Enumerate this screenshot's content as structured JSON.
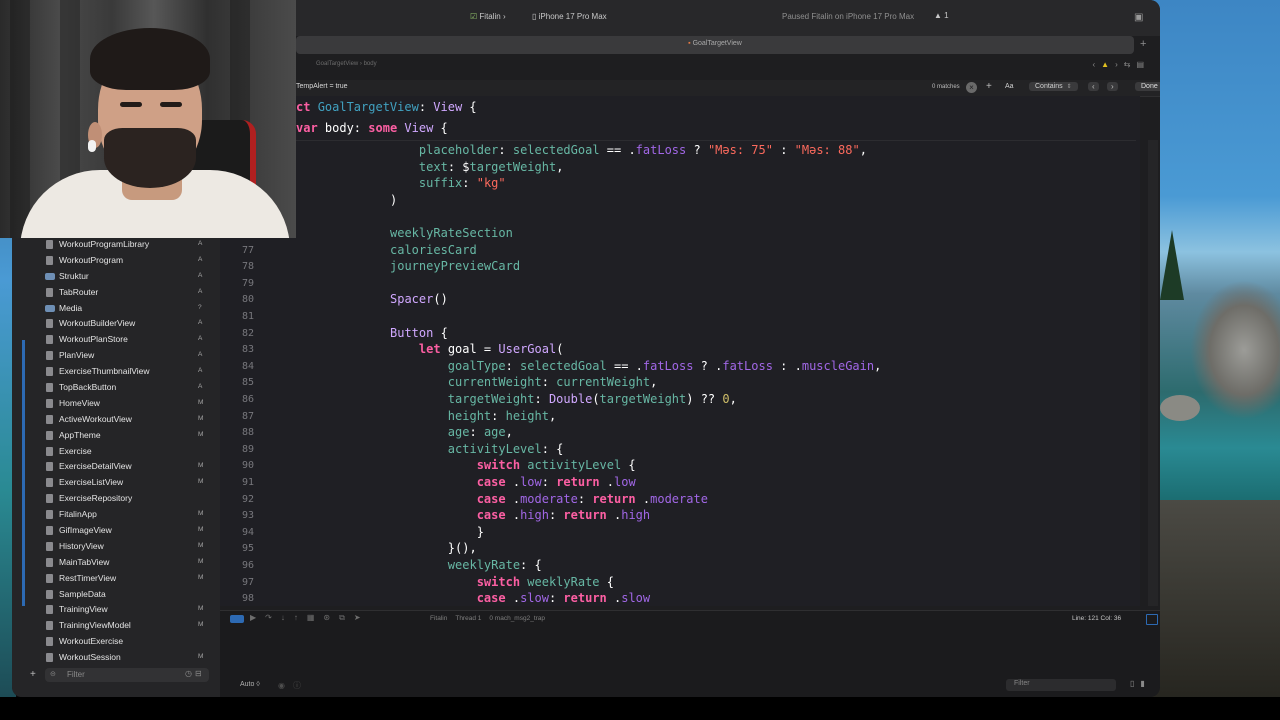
{
  "toolbar": {
    "scheme": "Fitalin",
    "device": "iPhone 17 Pro Max",
    "status": "Paused Fitalin on iPhone 17 Pro Max",
    "warnings": "1"
  },
  "tab": {
    "title": "GoalTargetView"
  },
  "jumpbar": {
    "path": "GoalTargetView  ›  body"
  },
  "find": {
    "query": "TempAlert = true",
    "matches": "0 matches",
    "case_label": "Aa",
    "mode": "Contains",
    "done_label": "Done"
  },
  "navigator": {
    "items": [
      {
        "label": "WorkoutProgramLibrary",
        "badge": "A",
        "kind": "file"
      },
      {
        "label": "WorkoutProgram",
        "badge": "A",
        "kind": "file"
      },
      {
        "label": "Struktur",
        "badge": "A",
        "kind": "folder"
      },
      {
        "label": "TabRouter",
        "badge": "A",
        "kind": "file"
      },
      {
        "label": "Media",
        "badge": "?",
        "kind": "folder"
      },
      {
        "label": "WorkoutBuilderView",
        "badge": "A",
        "kind": "file"
      },
      {
        "label": "WorkoutPlanStore",
        "badge": "A",
        "kind": "file"
      },
      {
        "label": "PlanView",
        "badge": "A",
        "kind": "file"
      },
      {
        "label": "ExerciseThumbnailView",
        "badge": "A",
        "kind": "file"
      },
      {
        "label": "TopBackButton",
        "badge": "A",
        "kind": "file"
      },
      {
        "label": "HomeView",
        "badge": "M",
        "kind": "file"
      },
      {
        "label": "ActiveWorkoutView",
        "badge": "M",
        "kind": "file"
      },
      {
        "label": "AppTheme",
        "badge": "M",
        "kind": "file"
      },
      {
        "label": "Exercise",
        "badge": "",
        "kind": "file"
      },
      {
        "label": "ExerciseDetailView",
        "badge": "M",
        "kind": "file"
      },
      {
        "label": "ExerciseListView",
        "badge": "M",
        "kind": "file"
      },
      {
        "label": "ExerciseRepository",
        "badge": "",
        "kind": "file"
      },
      {
        "label": "FitalinApp",
        "badge": "M",
        "kind": "file"
      },
      {
        "label": "GifImageView",
        "badge": "M",
        "kind": "file"
      },
      {
        "label": "HistoryView",
        "badge": "M",
        "kind": "file"
      },
      {
        "label": "MainTabView",
        "badge": "M",
        "kind": "file"
      },
      {
        "label": "RestTimerView",
        "badge": "M",
        "kind": "file"
      },
      {
        "label": "SampleData",
        "badge": "",
        "kind": "file"
      },
      {
        "label": "TrainingView",
        "badge": "M",
        "kind": "file"
      },
      {
        "label": "TrainingViewModel",
        "badge": "M",
        "kind": "file"
      },
      {
        "label": "WorkoutExercise",
        "badge": "",
        "kind": "file"
      },
      {
        "label": "WorkoutSession",
        "badge": "M",
        "kind": "file"
      }
    ],
    "filter_placeholder": "Filter"
  },
  "editor": {
    "scope_lines": [
      [
        [
          "kw",
          "ct "
        ],
        [
          "decl",
          "GoalTargetView"
        ],
        [
          "plain",
          ": "
        ],
        [
          "type",
          "View"
        ],
        [
          "plain",
          " {"
        ]
      ],
      [
        [
          "kw",
          "var "
        ],
        [
          "plain",
          "body: "
        ],
        [
          "kw",
          "some "
        ],
        [
          "type",
          "View"
        ],
        [
          "plain",
          " {"
        ]
      ]
    ],
    "lines": [
      {
        "n": "",
        "parts": [
          [
            "plain",
            "    "
          ],
          [
            "prop",
            "placeholder"
          ],
          [
            "plain",
            ": "
          ],
          [
            "prop",
            "selectedGoal"
          ],
          [
            "plain",
            " == ."
          ],
          [
            "enum",
            "fatLoss"
          ],
          [
            "plain",
            " ? "
          ],
          [
            "str",
            "\"Məs: 75\""
          ],
          [
            "plain",
            " : "
          ],
          [
            "str",
            "\"Məs: 88\""
          ],
          [
            "plain",
            ","
          ]
        ]
      },
      {
        "n": "",
        "parts": [
          [
            "plain",
            "    "
          ],
          [
            "prop",
            "text"
          ],
          [
            "plain",
            ": $"
          ],
          [
            "prop",
            "targetWeight"
          ],
          [
            "plain",
            ","
          ]
        ]
      },
      {
        "n": "",
        "parts": [
          [
            "plain",
            "    "
          ],
          [
            "prop",
            "suffix"
          ],
          [
            "plain",
            ": "
          ],
          [
            "str",
            "\"kg\""
          ]
        ]
      },
      {
        "n": "",
        "parts": [
          [
            "plain",
            ")"
          ]
        ]
      },
      {
        "n": "",
        "parts": [
          [
            "plain",
            ""
          ]
        ]
      },
      {
        "n": "",
        "parts": [
          [
            "fn",
            "weeklyRateSection"
          ]
        ]
      },
      {
        "n": "77",
        "parts": [
          [
            "fn",
            "caloriesCard"
          ]
        ]
      },
      {
        "n": "78",
        "parts": [
          [
            "fn",
            "journeyPreviewCard"
          ]
        ]
      },
      {
        "n": "79",
        "parts": [
          [
            "plain",
            ""
          ]
        ]
      },
      {
        "n": "80",
        "parts": [
          [
            "type",
            "Spacer"
          ],
          [
            "plain",
            "()"
          ]
        ]
      },
      {
        "n": "81",
        "parts": [
          [
            "plain",
            ""
          ]
        ]
      },
      {
        "n": "82",
        "parts": [
          [
            "type",
            "Button"
          ],
          [
            "plain",
            " {"
          ]
        ]
      },
      {
        "n": "83",
        "parts": [
          [
            "plain",
            "    "
          ],
          [
            "kw",
            "let "
          ],
          [
            "plain",
            "goal = "
          ],
          [
            "type",
            "UserGoal"
          ],
          [
            "plain",
            "("
          ]
        ]
      },
      {
        "n": "84",
        "parts": [
          [
            "plain",
            "        "
          ],
          [
            "prop",
            "goalType"
          ],
          [
            "plain",
            ": "
          ],
          [
            "prop",
            "selectedGoal"
          ],
          [
            "plain",
            " == ."
          ],
          [
            "enum",
            "fatLoss"
          ],
          [
            "plain",
            " ? ."
          ],
          [
            "enum",
            "fatLoss"
          ],
          [
            "plain",
            " : ."
          ],
          [
            "enum",
            "muscleGain"
          ],
          [
            "plain",
            ","
          ]
        ]
      },
      {
        "n": "85",
        "parts": [
          [
            "plain",
            "        "
          ],
          [
            "prop",
            "currentWeight"
          ],
          [
            "plain",
            ": "
          ],
          [
            "prop",
            "currentWeight"
          ],
          [
            "plain",
            ","
          ]
        ]
      },
      {
        "n": "86",
        "parts": [
          [
            "plain",
            "        "
          ],
          [
            "prop",
            "targetWeight"
          ],
          [
            "plain",
            ": "
          ],
          [
            "type",
            "Double"
          ],
          [
            "plain",
            "("
          ],
          [
            "prop",
            "targetWeight"
          ],
          [
            "plain",
            ") ?? "
          ],
          [
            "num",
            "0"
          ],
          [
            "plain",
            ","
          ]
        ]
      },
      {
        "n": "87",
        "parts": [
          [
            "plain",
            "        "
          ],
          [
            "prop",
            "height"
          ],
          [
            "plain",
            ": "
          ],
          [
            "prop",
            "height"
          ],
          [
            "plain",
            ","
          ]
        ]
      },
      {
        "n": "88",
        "parts": [
          [
            "plain",
            "        "
          ],
          [
            "prop",
            "age"
          ],
          [
            "plain",
            ": "
          ],
          [
            "prop",
            "age"
          ],
          [
            "plain",
            ","
          ]
        ]
      },
      {
        "n": "89",
        "parts": [
          [
            "plain",
            "        "
          ],
          [
            "prop",
            "activityLevel"
          ],
          [
            "plain",
            ": {"
          ]
        ]
      },
      {
        "n": "90",
        "parts": [
          [
            "plain",
            "            "
          ],
          [
            "kw",
            "switch "
          ],
          [
            "prop",
            "activityLevel"
          ],
          [
            "plain",
            " {"
          ]
        ]
      },
      {
        "n": "91",
        "parts": [
          [
            "plain",
            "            "
          ],
          [
            "kw",
            "case "
          ],
          [
            "plain",
            "."
          ],
          [
            "enum",
            "low"
          ],
          [
            "plain",
            ": "
          ],
          [
            "kw",
            "return "
          ],
          [
            "plain",
            "."
          ],
          [
            "enum",
            "low"
          ]
        ]
      },
      {
        "n": "92",
        "parts": [
          [
            "plain",
            "            "
          ],
          [
            "kw",
            "case "
          ],
          [
            "plain",
            "."
          ],
          [
            "enum",
            "moderate"
          ],
          [
            "plain",
            ": "
          ],
          [
            "kw",
            "return "
          ],
          [
            "plain",
            "."
          ],
          [
            "enum",
            "moderate"
          ]
        ]
      },
      {
        "n": "93",
        "parts": [
          [
            "plain",
            "            "
          ],
          [
            "kw",
            "case "
          ],
          [
            "plain",
            "."
          ],
          [
            "enum",
            "high"
          ],
          [
            "plain",
            ": "
          ],
          [
            "kw",
            "return "
          ],
          [
            "plain",
            "."
          ],
          [
            "enum",
            "high"
          ]
        ]
      },
      {
        "n": "94",
        "parts": [
          [
            "plain",
            "            }"
          ]
        ]
      },
      {
        "n": "95",
        "parts": [
          [
            "plain",
            "        }(),"
          ]
        ]
      },
      {
        "n": "96",
        "parts": [
          [
            "plain",
            "        "
          ],
          [
            "prop",
            "weeklyRate"
          ],
          [
            "plain",
            ": {"
          ]
        ]
      },
      {
        "n": "97",
        "parts": [
          [
            "plain",
            "            "
          ],
          [
            "kw",
            "switch "
          ],
          [
            "prop",
            "weeklyRate"
          ],
          [
            "plain",
            " {"
          ]
        ]
      },
      {
        "n": "98",
        "parts": [
          [
            "plain",
            "            "
          ],
          [
            "kw",
            "case "
          ],
          [
            "plain",
            "."
          ],
          [
            "enum",
            "slow"
          ],
          [
            "plain",
            ": "
          ],
          [
            "kw",
            "return "
          ],
          [
            "plain",
            "."
          ],
          [
            "enum",
            "slow"
          ]
        ]
      }
    ]
  },
  "debug": {
    "crumbs": [
      "Fitalin",
      "Thread 1",
      "0 mach_msg2_trap"
    ],
    "line_col": "Line: 121  Col: 36"
  },
  "console": {
    "auto_label": "Auto ◊",
    "filter_placeholder": "Filter"
  },
  "colors": {
    "keyword": "#fc5fa3",
    "type": "#d0a8ff",
    "declaration": "#41a1c0",
    "function": "#67b7a4",
    "string": "#fc6a5d",
    "number": "#d0bf69",
    "enum_case": "#a167e6",
    "accent_blue": "#2d6ab3"
  }
}
